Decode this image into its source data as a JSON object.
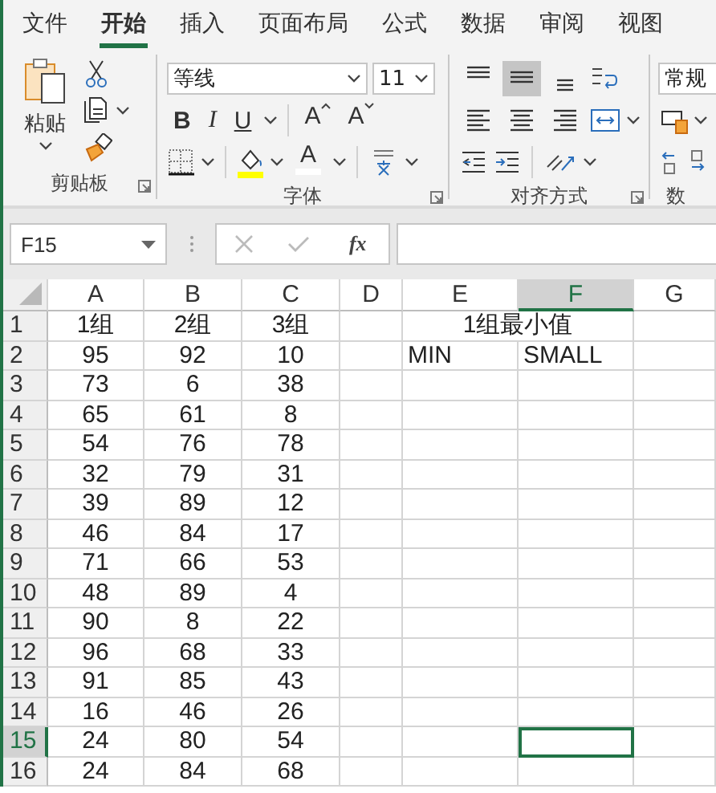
{
  "tabs": [
    {
      "label": "文件",
      "selected": false
    },
    {
      "label": "开始",
      "selected": true
    },
    {
      "label": "插入",
      "selected": false
    },
    {
      "label": "页面布局",
      "selected": false
    },
    {
      "label": "公式",
      "selected": false
    },
    {
      "label": "数据",
      "selected": false
    },
    {
      "label": "审阅",
      "selected": false
    },
    {
      "label": "视图",
      "selected": false
    }
  ],
  "ribbon": {
    "clipboard": {
      "paste_label": "粘贴",
      "group_label": "剪贴板"
    },
    "font": {
      "font_name": "等线",
      "font_size": "11",
      "bold": "B",
      "italic": "I",
      "underline": "U",
      "grow": "A",
      "shrink": "A",
      "font_color": "A",
      "group_label": "字体"
    },
    "alignment": {
      "vertical": [
        {
          "kind": "top",
          "pressed": false
        },
        {
          "kind": "middle",
          "pressed": true
        },
        {
          "kind": "bottom",
          "pressed": false
        }
      ],
      "horizontal": [
        {
          "kind": "left",
          "pressed": false
        },
        {
          "kind": "center",
          "pressed": false
        },
        {
          "kind": "right",
          "pressed": false
        }
      ],
      "group_label": "对齐方式"
    },
    "number": {
      "format": "常规",
      "group_label": "数"
    }
  },
  "formula_bar": {
    "name_box": "F15",
    "function_label": "fx"
  },
  "sheet": {
    "columns": [
      {
        "label": "A",
        "selected": false
      },
      {
        "label": "B",
        "selected": false
      },
      {
        "label": "C",
        "selected": false
      },
      {
        "label": "D",
        "selected": false
      },
      {
        "label": "E",
        "selected": false
      },
      {
        "label": "F",
        "selected": true
      },
      {
        "label": "G",
        "selected": false
      }
    ],
    "rows": [
      {
        "label": "1",
        "selected": false,
        "groups": [
          "1组",
          "2组",
          "3组"
        ],
        "merged_heading": "1组最小值"
      },
      {
        "label": "2",
        "selected": false,
        "groups": [
          "95",
          "92",
          "10"
        ],
        "labels": [
          "MIN",
          "SMALL"
        ]
      },
      {
        "label": "3",
        "selected": false,
        "groups": [
          "73",
          "6",
          "38"
        ]
      },
      {
        "label": "4",
        "selected": false,
        "groups": [
          "65",
          "61",
          "8"
        ]
      },
      {
        "label": "5",
        "selected": false,
        "groups": [
          "54",
          "76",
          "78"
        ]
      },
      {
        "label": "6",
        "selected": false,
        "groups": [
          "32",
          "79",
          "31"
        ]
      },
      {
        "label": "7",
        "selected": false,
        "groups": [
          "39",
          "89",
          "12"
        ]
      },
      {
        "label": "8",
        "selected": false,
        "groups": [
          "46",
          "84",
          "17"
        ]
      },
      {
        "label": "9",
        "selected": false,
        "groups": [
          "71",
          "66",
          "53"
        ]
      },
      {
        "label": "10",
        "selected": false,
        "groups": [
          "48",
          "89",
          "4"
        ]
      },
      {
        "label": "11",
        "selected": false,
        "groups": [
          "90",
          "8",
          "22"
        ]
      },
      {
        "label": "12",
        "selected": false,
        "groups": [
          "96",
          "68",
          "33"
        ]
      },
      {
        "label": "13",
        "selected": false,
        "groups": [
          "91",
          "85",
          "43"
        ]
      },
      {
        "label": "14",
        "selected": false,
        "groups": [
          "16",
          "46",
          "26"
        ]
      },
      {
        "label": "15",
        "selected": true,
        "groups": [
          "24",
          "80",
          "54"
        ]
      },
      {
        "label": "16",
        "selected": false,
        "groups": [
          "24",
          "84",
          "68"
        ]
      }
    ]
  }
}
